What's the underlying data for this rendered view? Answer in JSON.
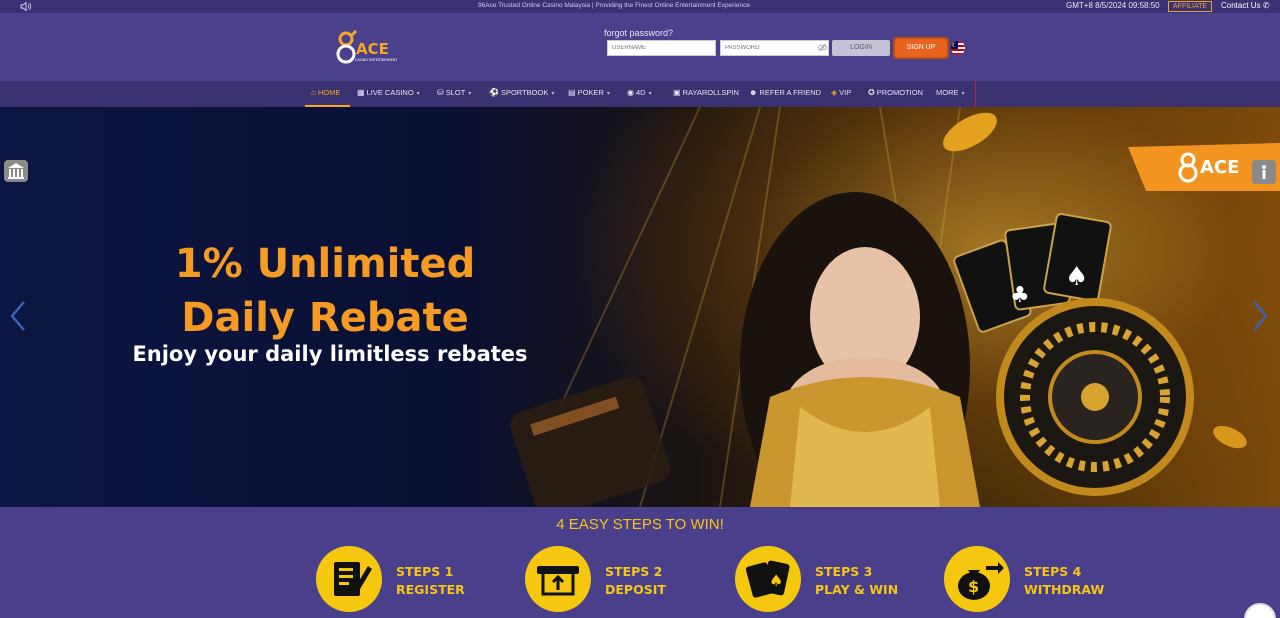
{
  "topbar": {
    "tagline": "96Ace Trusted Online Casino Malaysia | Providing the Finest Online Entertainment Experience",
    "clock": "GMT+8 8/5/2024 09:58:50",
    "affiliate": "AFFILIATE",
    "contact": "Contact Us"
  },
  "header": {
    "logo_text": "ACE",
    "logo_sub": "CASINO ENTERTAINMENT",
    "forgot_password": "forgot password?",
    "username_placeholder": "USERNAME",
    "password_placeholder": "PASSWORD",
    "login_label": "LOGIN",
    "signup_label": "SIGN UP"
  },
  "nav": {
    "items": [
      {
        "label": "HOME",
        "icon": "home-icon"
      },
      {
        "label": "LIVE CASINO",
        "icon": "cards-icon"
      },
      {
        "label": "SLOT",
        "icon": "slot-icon"
      },
      {
        "label": "SPORTBOOK",
        "icon": "ball-icon"
      },
      {
        "label": "POKER",
        "icon": "poker-icon"
      },
      {
        "label": "4D",
        "icon": "eye-icon"
      },
      {
        "label": "RAYAROLLSPIN",
        "icon": "calendar-icon"
      },
      {
        "label": "REFER A FRIEND",
        "icon": "people-icon"
      },
      {
        "label": "VIP",
        "icon": "tag-icon"
      },
      {
        "label": "PROMOTION",
        "icon": "gift-icon"
      },
      {
        "label": "MORE",
        "icon": ""
      }
    ]
  },
  "banner": {
    "headline_line1": "1% Unlimited",
    "headline_line2": "Daily Rebate",
    "subline": "Enjoy your daily limitless rebates",
    "badge_text": "ACE"
  },
  "steps": {
    "title": "4 EASY STEPS TO WIN!",
    "items": [
      {
        "line1": "STEPS 1",
        "line2": "REGISTER",
        "icon": "register-icon"
      },
      {
        "line1": "STEPS 2",
        "line2": "DEPOSIT",
        "icon": "deposit-icon"
      },
      {
        "line1": "STEPS 3",
        "line2": "PLAY & WIN",
        "icon": "play-cards-icon"
      },
      {
        "line1": "STEPS 4",
        "line2": "WITHDRAW",
        "icon": "money-bag-icon"
      }
    ]
  },
  "colors": {
    "background": "#4a3f8a",
    "nav": "#3a3171",
    "accent": "#f5a623",
    "signup": "#e8641e",
    "step_yellow": "#f5c80f"
  }
}
